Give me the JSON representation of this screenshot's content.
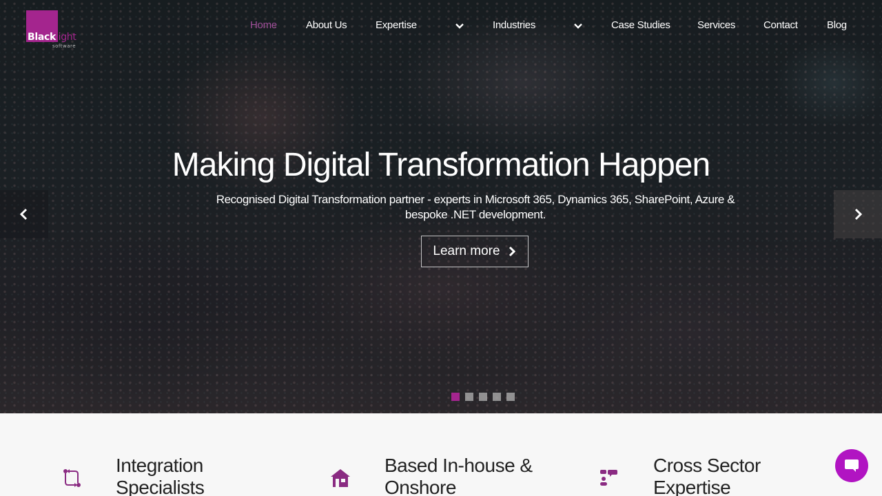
{
  "brand": {
    "name_bold": "Black",
    "name_light": "light",
    "tagline": "software",
    "accent_color": "#a4258e"
  },
  "nav": {
    "items": [
      {
        "label": "Home",
        "active": true
      },
      {
        "label": "About Us"
      },
      {
        "label": "Expertise",
        "has_dropdown": true
      },
      {
        "label": "Industries",
        "has_dropdown": true
      },
      {
        "label": "Case Studies"
      },
      {
        "label": "Services"
      },
      {
        "label": "Contact"
      },
      {
        "label": "Blog"
      }
    ]
  },
  "hero": {
    "title": "Making Digital Transformation Happen",
    "subtitle_line1": "Recognised Digital Transformation partner - experts in Microsoft 365, Dynamics 365, SharePoint, Azure &",
    "subtitle_line2": "bespoke .NET development.",
    "cta_label": "Learn more",
    "slides_total": 5,
    "active_slide": 1
  },
  "features": [
    {
      "icon": "integration-arrows-icon",
      "title_line1": "Integration",
      "title_line2": "Specialists"
    },
    {
      "icon": "house-icon",
      "title_line1": "Based In-house &",
      "title_line2": "Onshore"
    },
    {
      "icon": "sitemap-icon",
      "title_line1": "Cross Sector",
      "title_line2": "Expertise"
    }
  ],
  "chat": {
    "icon": "chat-bubble-icon",
    "color": "#b114c2"
  }
}
